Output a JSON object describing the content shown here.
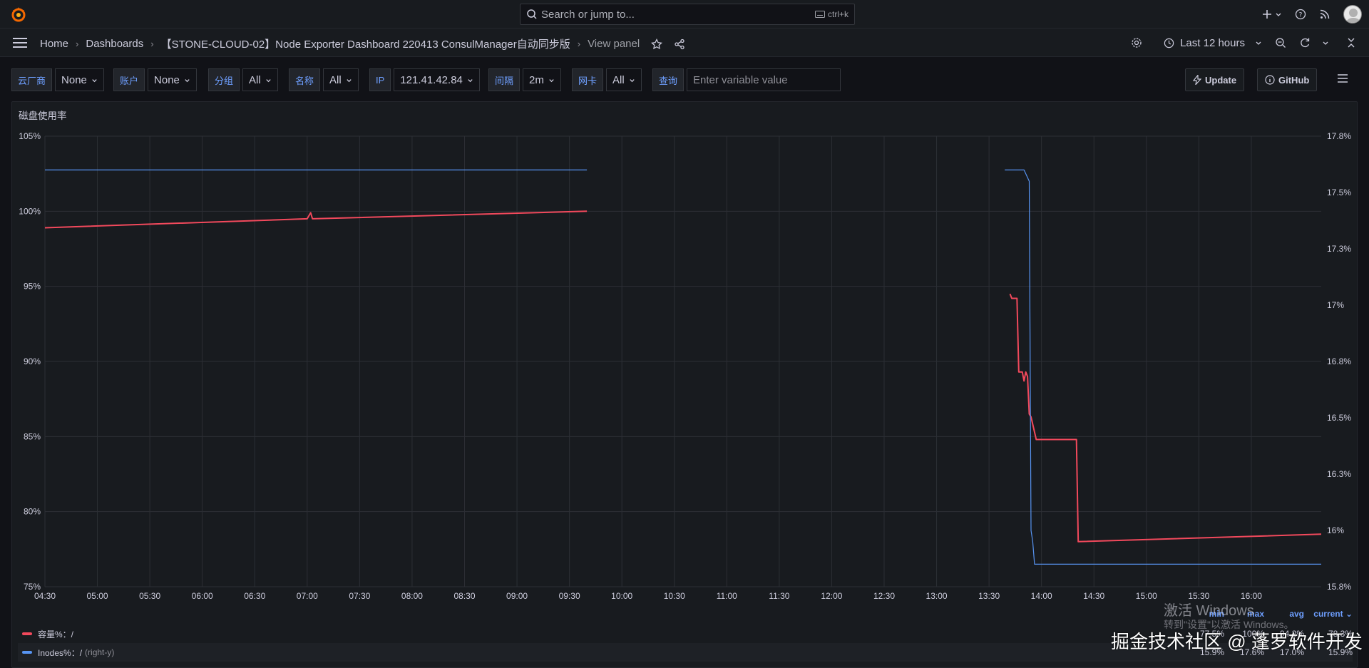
{
  "topbar": {
    "search_placeholder": "Search or jump to...",
    "search_shortcut": "ctrl+k"
  },
  "breadcrumbs": [
    "Home",
    "Dashboards",
    "【STONE-CLOUD-02】Node Exporter Dashboard 220413 ConsulManager自动同步版",
    "View panel"
  ],
  "time_range": "Last 12 hours",
  "variables": [
    {
      "label": "云厂商",
      "value": "None"
    },
    {
      "label": "账户",
      "value": "None"
    },
    {
      "label": "分组",
      "value": "All"
    },
    {
      "label": "名称",
      "value": "All"
    },
    {
      "label": "IP",
      "value": "121.41.42.84"
    },
    {
      "label": "间隔",
      "value": "2m"
    },
    {
      "label": "网卡",
      "value": "All"
    },
    {
      "label": "查询",
      "value": "",
      "placeholder": "Enter variable value"
    }
  ],
  "buttons": {
    "update": "Update",
    "github": "GitHub"
  },
  "panel": {
    "title": "磁盘使用率"
  },
  "colors": {
    "capacity": "#f2495c",
    "inodes": "#5794f2",
    "accent": "#6e9fff"
  },
  "chart_data": {
    "type": "line",
    "title": "磁盘使用率",
    "x_ticks": [
      "04:30",
      "05:00",
      "05:30",
      "06:00",
      "06:30",
      "07:00",
      "07:30",
      "08:00",
      "08:30",
      "09:00",
      "09:30",
      "10:00",
      "10:30",
      "11:00",
      "11:30",
      "12:00",
      "12:30",
      "13:00",
      "13:30",
      "14:00",
      "14:30",
      "15:00",
      "15:30",
      "16:00"
    ],
    "xlim_minutes": [
      270,
      1000
    ],
    "y_left": {
      "ticks": [
        "105%",
        "100%",
        "95%",
        "90%",
        "85%",
        "80%",
        "75%"
      ],
      "range": [
        75,
        105
      ]
    },
    "y_right": {
      "ticks": [
        "17.8%",
        "17.5%",
        "17.3%",
        "17%",
        "16.8%",
        "16.5%",
        "16.3%",
        "16%",
        "15.8%"
      ],
      "range": [
        15.8,
        17.8
      ]
    },
    "series": [
      {
        "name": "容量%：/",
        "axis": "left",
        "color": "#f2495c",
        "points": [
          [
            270,
            98.9
          ],
          [
            420,
            99.5
          ],
          [
            422,
            99.9
          ],
          [
            423,
            99.5
          ],
          [
            580,
            100.0
          ],
          [
            820,
            null
          ],
          [
            822,
            94.5
          ],
          [
            823,
            94.2
          ],
          [
            826,
            94.2
          ],
          [
            827,
            89.3
          ],
          [
            829,
            89.3
          ],
          [
            830,
            88.7
          ],
          [
            831,
            89.3
          ],
          [
            832,
            89.0
          ],
          [
            833,
            86.5
          ],
          [
            834,
            86.3
          ],
          [
            836,
            85.3
          ],
          [
            837,
            84.8
          ],
          [
            860,
            84.8
          ],
          [
            861,
            78.0
          ],
          [
            1000,
            78.5
          ]
        ]
      },
      {
        "name": "Inodes%：/",
        "axis": "right",
        "color": "#5794f2",
        "points": [
          [
            270,
            17.65
          ],
          [
            580,
            17.65
          ],
          [
            820,
            null
          ],
          [
            819,
            17.65
          ],
          [
            830,
            17.65
          ],
          [
            833,
            17.6
          ],
          [
            834,
            16.05
          ],
          [
            835,
            16.0
          ],
          [
            836,
            15.9
          ],
          [
            1000,
            15.9
          ]
        ]
      }
    ],
    "legend": {
      "placement": "bottom",
      "columns": [
        "min",
        "max",
        "avg",
        "current"
      ],
      "rows": [
        {
          "name": "容量%：/",
          "axis": "",
          "min": "77.5%",
          "max": "100%",
          "avg": "94.2%",
          "current": "78.3%"
        },
        {
          "name": "Inodes%：/",
          "axis": "(right-y)",
          "min": "15.9%",
          "max": "17.6%",
          "avg": "17.0%",
          "current": "15.9%"
        }
      ]
    }
  },
  "overlay": {
    "activate_line1": "激活 Windows",
    "activate_line2": "转到\"设置\"以激活 Windows。",
    "brand": "掘金技术社区 @ 蓬罗软件开发"
  }
}
